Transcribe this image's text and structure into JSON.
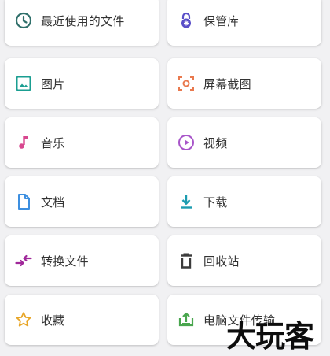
{
  "tiles": {
    "recent": {
      "label": "最近使用的文件",
      "icon": "clock-icon",
      "color": "#2f6f6a"
    },
    "vault": {
      "label": "保管库",
      "icon": "lock-icon",
      "color": "#5a4fc8"
    },
    "images": {
      "label": "图片",
      "icon": "image-icon",
      "color": "#1a9e91"
    },
    "screenshots": {
      "label": "屏幕截图",
      "icon": "screenshot-icon",
      "color": "#e9794e"
    },
    "music": {
      "label": "音乐",
      "icon": "music-note-icon",
      "color": "#d8478f"
    },
    "videos": {
      "label": "视频",
      "icon": "play-circle-icon",
      "color": "#a855c9"
    },
    "documents": {
      "label": "文档",
      "icon": "document-icon",
      "color": "#3d8fe0"
    },
    "downloads": {
      "label": "下载",
      "icon": "download-icon",
      "color": "#1c9cb0"
    },
    "convert": {
      "label": "转换文件",
      "icon": "convert-arrows-icon",
      "color": "#a0289a"
    },
    "recycle": {
      "label": "回收站",
      "icon": "trash-icon",
      "color": "#3c3c3c"
    },
    "favorites": {
      "label": "收藏",
      "icon": "star-icon",
      "color": "#e8a628"
    },
    "pc_transfer": {
      "label": "电脑文件传输",
      "icon": "upload-tray-icon",
      "color": "#49a64e"
    }
  },
  "watermark": {
    "text": "大玩客"
  }
}
